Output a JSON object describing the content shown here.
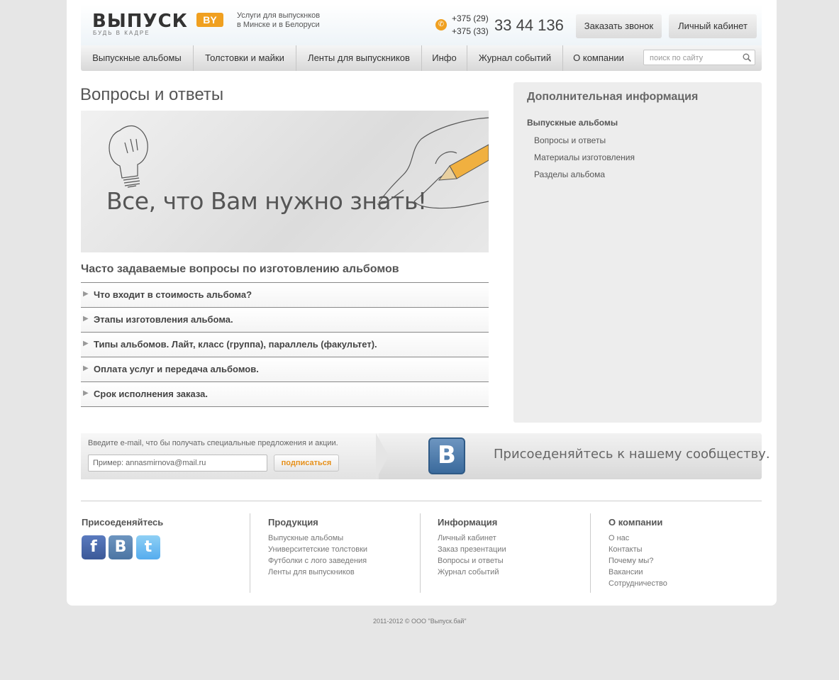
{
  "header": {
    "logo_text": "ВЫПУСК",
    "logo_suffix": "BY",
    "logo_slogan": "БУДЬ В КАДРЕ",
    "tagline_1": "Услуги для выпускнков",
    "tagline_2": "в Минске и в Белоруси",
    "phone_code_1": "+375 (29)",
    "phone_code_2": "+375 (33)",
    "phone_number": "33 44 136",
    "callback_label": "Заказать звонок",
    "cabinet_label": "Личный кабинет"
  },
  "nav": {
    "items": [
      {
        "label": "Выпускные альбомы"
      },
      {
        "label": "Толстовки и майки"
      },
      {
        "label": "Ленты для выпускников"
      },
      {
        "label": "Инфо"
      },
      {
        "label": "Журнал событий"
      },
      {
        "label": "О компании"
      }
    ],
    "search_placeholder": "поиск по сайту"
  },
  "main": {
    "title": "Вопросы и ответы",
    "banner_text": "Все, что Вам нужно знать!",
    "faq_heading": "Часто задаваемые вопросы по изготовлению альбомов",
    "faq": [
      {
        "q": "Что входит в стоимость альбома?"
      },
      {
        "q": "Этапы изготовления альбома."
      },
      {
        "q": "Типы альбомов. Лайт, класс (группа), параллель (факультет)."
      },
      {
        "q": "Оплата услуг и передача альбомов."
      },
      {
        "q": "Срок исполнения заказа."
      }
    ]
  },
  "sidebar": {
    "title": "Дополнительная информация",
    "category": "Выпускные альбомы",
    "links": [
      {
        "label": "Вопросы и ответы"
      },
      {
        "label": "Материалы изготовления"
      },
      {
        "label": "Разделы альбома"
      }
    ]
  },
  "subscribe": {
    "label": "Введите e-mail, что бы получать специальные предложения и акции.",
    "placeholder": "Пример: annasmirnova@mail.ru",
    "button": "подписаться",
    "vk_letter": "B",
    "community_text": "Присоеденяйтесь к нашему сообществу."
  },
  "footer": {
    "join_title": "Присоеденяйтесь",
    "social": [
      {
        "icon": "facebook-icon",
        "letter": "f",
        "color": "#3b5998"
      },
      {
        "icon": "vk-icon",
        "letter": "B",
        "color": "#4c75a3"
      },
      {
        "icon": "twitter-icon",
        "letter": "t",
        "color": "#55acee"
      }
    ],
    "columns": [
      {
        "title": "Продукция",
        "links": [
          "Выпускные альбомы",
          "Университетские толстовки",
          "Футболки с лого заведения",
          "Ленты для выпускников"
        ]
      },
      {
        "title": "Информация",
        "links": [
          "Личный кабинет",
          "Заказ презентации",
          "Вопросы и ответы",
          "Журнал событий"
        ]
      },
      {
        "title": "О компании",
        "links": [
          "О нас",
          "Контакты",
          "Почему мы?",
          "Вакансии",
          "Сотрудничество"
        ]
      }
    ],
    "copyright": "2011-2012  ©  ООО \"Выпуск.бай\""
  },
  "colors": {
    "accent": "#f0a020",
    "vk": "#4c75a3"
  }
}
